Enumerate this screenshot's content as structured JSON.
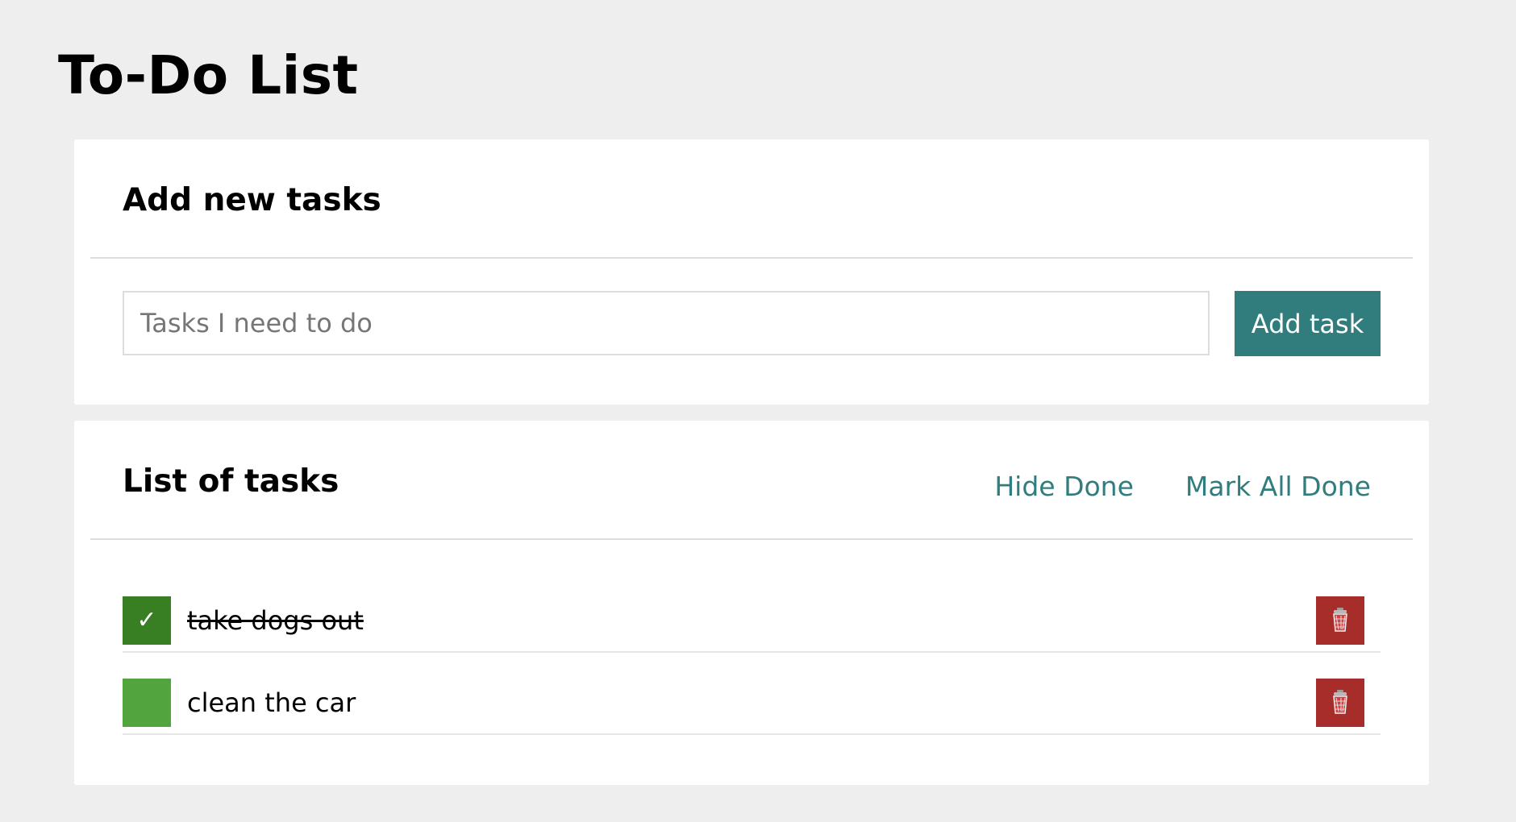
{
  "page": {
    "title": "To-Do List"
  },
  "add_section": {
    "heading": "Add new tasks",
    "input_placeholder": "Tasks I need to do",
    "input_value": "",
    "add_button_label": "Add task"
  },
  "list_section": {
    "heading": "List of tasks",
    "hide_done_label": "Hide Done",
    "mark_all_done_label": "Mark All Done",
    "tasks": [
      {
        "text": "take dogs out",
        "done": true,
        "check_mark": "✓",
        "toggle_icon": "check-icon",
        "delete_icon": "trash-icon"
      },
      {
        "text": "clean the car",
        "done": false,
        "check_mark": "",
        "toggle_icon": "empty-checkbox-icon",
        "delete_icon": "trash-icon"
      }
    ]
  },
  "colors": {
    "page_background": "#eeeeee",
    "card_background": "#ffffff",
    "accent_teal": "#317d7e",
    "done_green": "#387e22",
    "pending_green": "#51a43e",
    "delete_red": "#a62d2a",
    "divider": "#dddddd"
  }
}
